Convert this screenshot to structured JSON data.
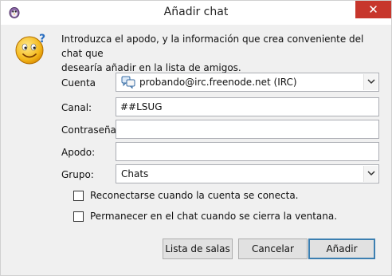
{
  "window": {
    "title": "Añadir chat",
    "close_glyph": "✕"
  },
  "intro": {
    "line1": "Introduzca el apodo, y la información que crea conveniente del chat que",
    "line2": "desearía añadir en la lista de amigos."
  },
  "form": {
    "account_label": "Cuenta",
    "account_value": "probando@irc.freenode.net (IRC)",
    "channel_label": "Canal:",
    "channel_value": "##LSUG",
    "password_label": "Contraseña:",
    "password_value": "",
    "nickname_label": "Apodo:",
    "nickname_value": "",
    "group_label": "Grupo:",
    "group_value": "Chats"
  },
  "options": {
    "reconnect_label": "Reconectarse cuando la cuenta se conecta.",
    "reconnect_checked": false,
    "persist_label": "Permanecer en el chat cuando se cierra la ventana.",
    "persist_checked": false
  },
  "buttons": {
    "room_list": "Lista de salas",
    "cancel": "Cancelar",
    "add": "Añadir"
  },
  "colors": {
    "close_red": "#c7362c",
    "default_button_border": "#3c7fb1"
  }
}
